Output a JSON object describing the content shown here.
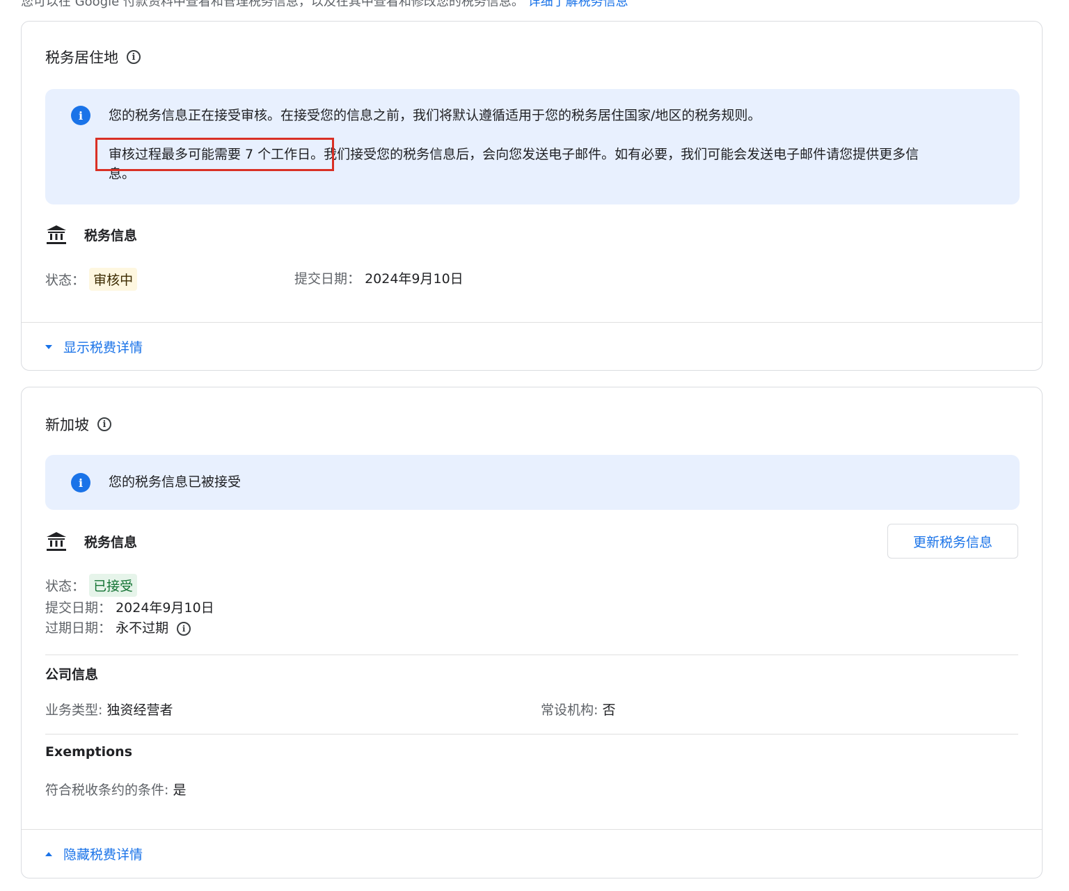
{
  "top_strip": {
    "text": "您可以在 Google 付款资料中查看和管理税务信息，以及在其中查看和修改您的税务信息。",
    "link": "详细了解税务信息"
  },
  "residence_card": {
    "title": "税务居住地",
    "banner_line1": "您的税务信息正在接受审核。在接受您的信息之前，我们将默认遵循适用于您的税务居住国家/地区的税务规则。",
    "banner_line2_highlight": "审核过程最多可能需要 7 个工作日。",
    "banner_line2_rest": "我们接受您的税务信息后，会向您发送电子邮件。如有必要，我们可能会发送电子邮件请您提供更多信",
    "banner_line3": "息。",
    "tax_info_label": "税务信息",
    "status_label": "状态：",
    "status_value": "审核中",
    "submit_label": "提交日期：",
    "submit_value": "2024年9月10日",
    "toggle_label": "显示税费详情"
  },
  "singapore_card": {
    "title": "新加坡",
    "banner_text": "您的税务信息已被接受",
    "tax_info_label": "税务信息",
    "update_button": "更新税务信息",
    "status_label": "状态：",
    "status_value": "已接受",
    "submit_label": "提交日期：",
    "submit_value": "2024年9月10日",
    "expire_label": "过期日期：",
    "expire_value": "永不过期",
    "company_title": "公司信息",
    "business_type_label": "业务类型: ",
    "business_type_value": "独资经营者",
    "permanent_label": "常设机构: ",
    "permanent_value": "否",
    "exemptions_title": "Exemptions",
    "treaty_label": "符合税收条约的条件: ",
    "treaty_value": "是",
    "toggle_label": "隐藏税费详情"
  },
  "colors": {
    "accent": "#1a73e8",
    "banner_bg": "#e8f0fe",
    "highlight": "#d93025",
    "pending_bg": "#fef7e0",
    "accepted_bg": "#e6f4ea",
    "accepted_text": "#137333"
  }
}
